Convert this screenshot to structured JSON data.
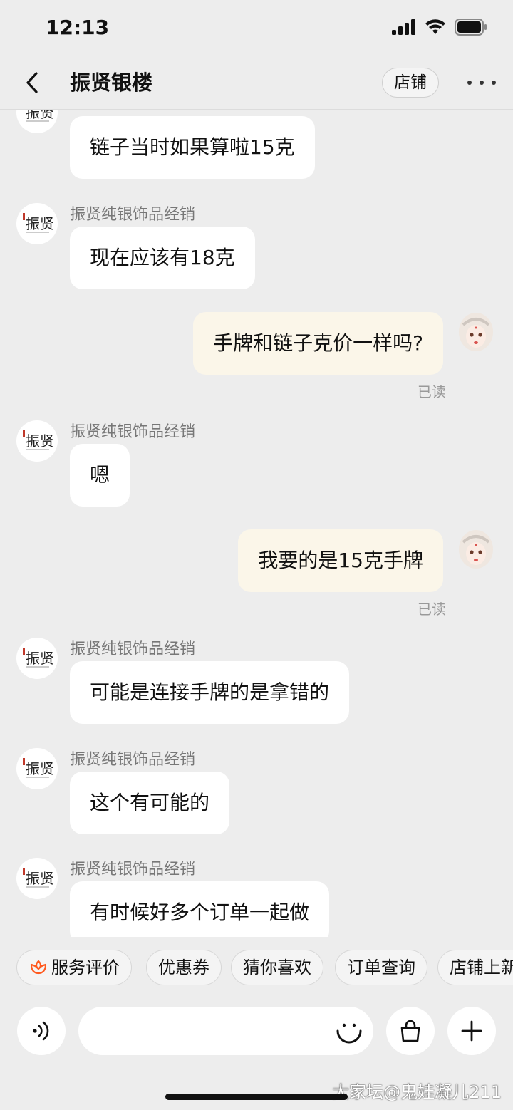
{
  "status_bar": {
    "time": "12:13"
  },
  "nav": {
    "title": "振贤银楼",
    "shop_label": "店铺"
  },
  "messages": [
    {
      "from": "shop",
      "sender": "",
      "text": "链子当时如果算啦15克"
    },
    {
      "from": "shop",
      "sender": "振贤纯银饰品经销",
      "text": "现在应该有18克"
    },
    {
      "from": "me",
      "text": "手牌和链子克价一样吗?",
      "status": "已读"
    },
    {
      "from": "shop",
      "sender": "振贤纯银饰品经销",
      "text": "嗯"
    },
    {
      "from": "me",
      "text": "我要的是15克手牌",
      "status": "已读"
    },
    {
      "from": "shop",
      "sender": "振贤纯银饰品经销",
      "text": "可能是连接手牌的是拿错的"
    },
    {
      "from": "shop",
      "sender": "振贤纯银饰品经销",
      "text": "这个有可能的"
    },
    {
      "from": "shop",
      "sender": "振贤纯银饰品经销",
      "text": "有时候好多个订单一起做"
    }
  ],
  "quick_actions": [
    "服务评价",
    "优惠券",
    "猜你喜欢",
    "订单查询",
    "店铺上新"
  ],
  "input": {
    "placeholder": ""
  },
  "watermark": "大家坛@鬼娃凝儿211",
  "colors": {
    "accent_orange": "#ff5a1f",
    "outgoing_bubble": "#fbf6e9",
    "incoming_bubble": "#ffffff",
    "background": "#ededed"
  },
  "icons": {
    "back": "chevron-left-icon",
    "more": "more-dots-icon",
    "voice": "voice-icon",
    "emoji": "emoji-icon",
    "bag": "shopping-bag-icon",
    "plus": "plus-icon",
    "review": "flower-icon"
  }
}
